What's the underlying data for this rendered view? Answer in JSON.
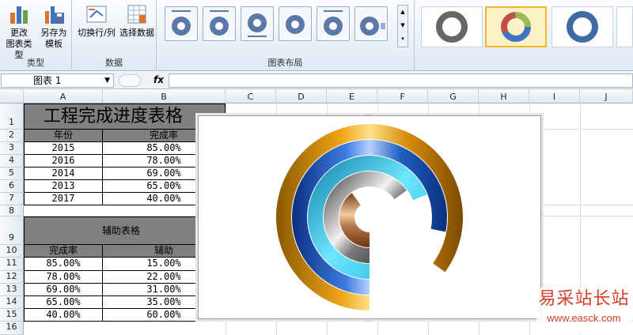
{
  "ribbon": {
    "groups": {
      "type": {
        "label": "类型",
        "buttons": [
          {
            "label1": "更改",
            "label2": "图表类型"
          },
          {
            "label1": "另存为",
            "label2": "模板"
          }
        ]
      },
      "data": {
        "label": "数据",
        "buttons": [
          {
            "label": "切换行/列"
          },
          {
            "label": "选择数据"
          }
        ]
      },
      "layout": {
        "label": "图表布局"
      }
    }
  },
  "formula_bar": {
    "name_box": "图表 1",
    "fx": "fx",
    "value": ""
  },
  "columns": [
    "A",
    "B",
    "C",
    "D",
    "E",
    "F",
    "G",
    "H",
    "I",
    "J"
  ],
  "rows": [
    "1",
    "2",
    "3",
    "4",
    "5",
    "6",
    "7",
    "8",
    "9",
    "10",
    "11",
    "12",
    "13",
    "14",
    "15",
    "16"
  ],
  "table1": {
    "title": "工程完成进度表格",
    "headers": [
      "年份",
      "完成率"
    ],
    "rows": [
      [
        "2015",
        "85.00%"
      ],
      [
        "2016",
        "78.00%"
      ],
      [
        "2014",
        "69.00%"
      ],
      [
        "2013",
        "65.00%"
      ],
      [
        "2017",
        "40.00%"
      ]
    ]
  },
  "table2": {
    "title": "辅助表格",
    "headers": [
      "完成率",
      "辅助"
    ],
    "rows": [
      [
        "85.00%",
        "15.00%"
      ],
      [
        "78.00%",
        "22.00%"
      ],
      [
        "69.00%",
        "31.00%"
      ],
      [
        "65.00%",
        "35.00%"
      ],
      [
        "40.00%",
        "60.00%"
      ]
    ]
  },
  "chart_data": {
    "type": "doughnut",
    "series": [
      {
        "name": "2015",
        "value": 0.85,
        "color": "#d98c0c"
      },
      {
        "name": "2016",
        "value": 0.78,
        "color": "#1f5fbf"
      },
      {
        "name": "2014",
        "value": 0.69,
        "color": "#1ab3d9"
      },
      {
        "name": "2013",
        "value": 0.65,
        "color": "#888888"
      },
      {
        "name": "2017",
        "value": 0.4,
        "color": "#b8794a"
      }
    ]
  },
  "watermark": {
    "line1": "易采站长站",
    "line2": "www.easck.com"
  }
}
